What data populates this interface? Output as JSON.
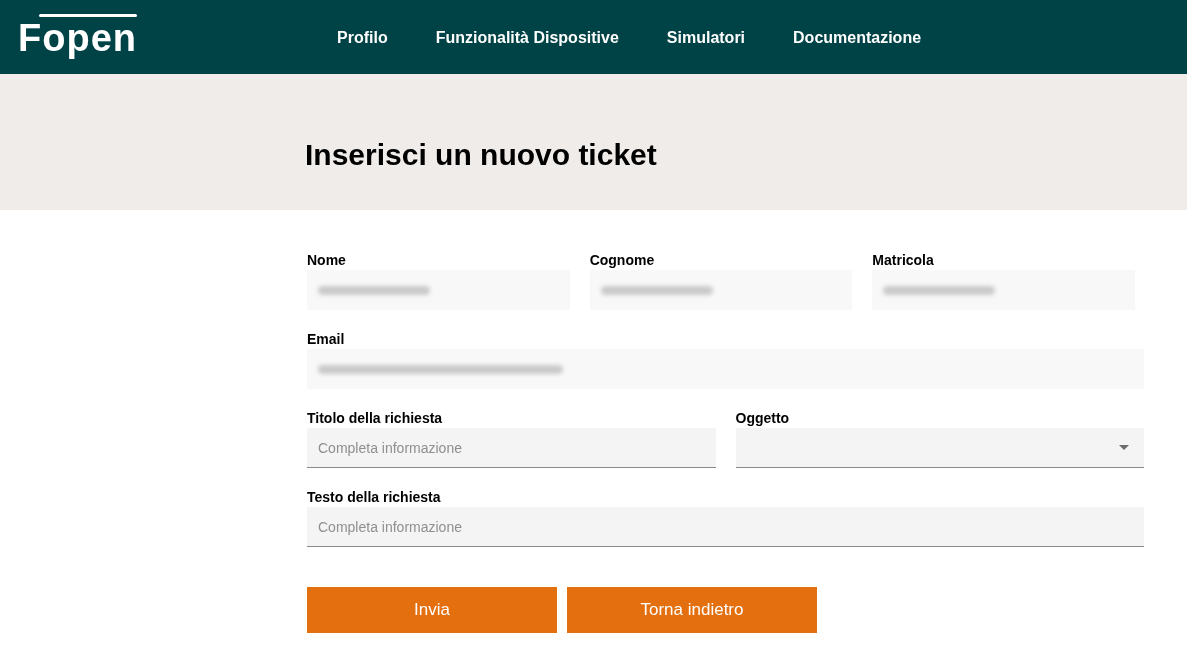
{
  "header": {
    "logo": "Fopen",
    "nav": [
      "Profilo",
      "Funzionalità Dispositive",
      "Simulatori",
      "Documentazione"
    ]
  },
  "title": "Inserisci un nuovo ticket",
  "form": {
    "rows": [
      {
        "fields": [
          {
            "kind": "readonly",
            "label": "Nome",
            "redacted": true
          },
          {
            "kind": "readonly",
            "label": "Cognome",
            "redacted": true
          },
          {
            "kind": "readonly",
            "label": "Matricola",
            "redacted": true
          }
        ]
      },
      {
        "fields": [
          {
            "kind": "readonly",
            "label": "Email",
            "redacted": true
          }
        ]
      },
      {
        "fields": [
          {
            "kind": "text",
            "label": "Titolo della richiesta",
            "placeholder": "Completa informazione"
          },
          {
            "kind": "select",
            "label": "Oggetto"
          }
        ]
      },
      {
        "fields": [
          {
            "kind": "text",
            "label": "Testo della richiesta",
            "placeholder": "Completa informazione"
          }
        ]
      }
    ]
  },
  "buttons": [
    "Invia",
    "Torna indietro"
  ]
}
